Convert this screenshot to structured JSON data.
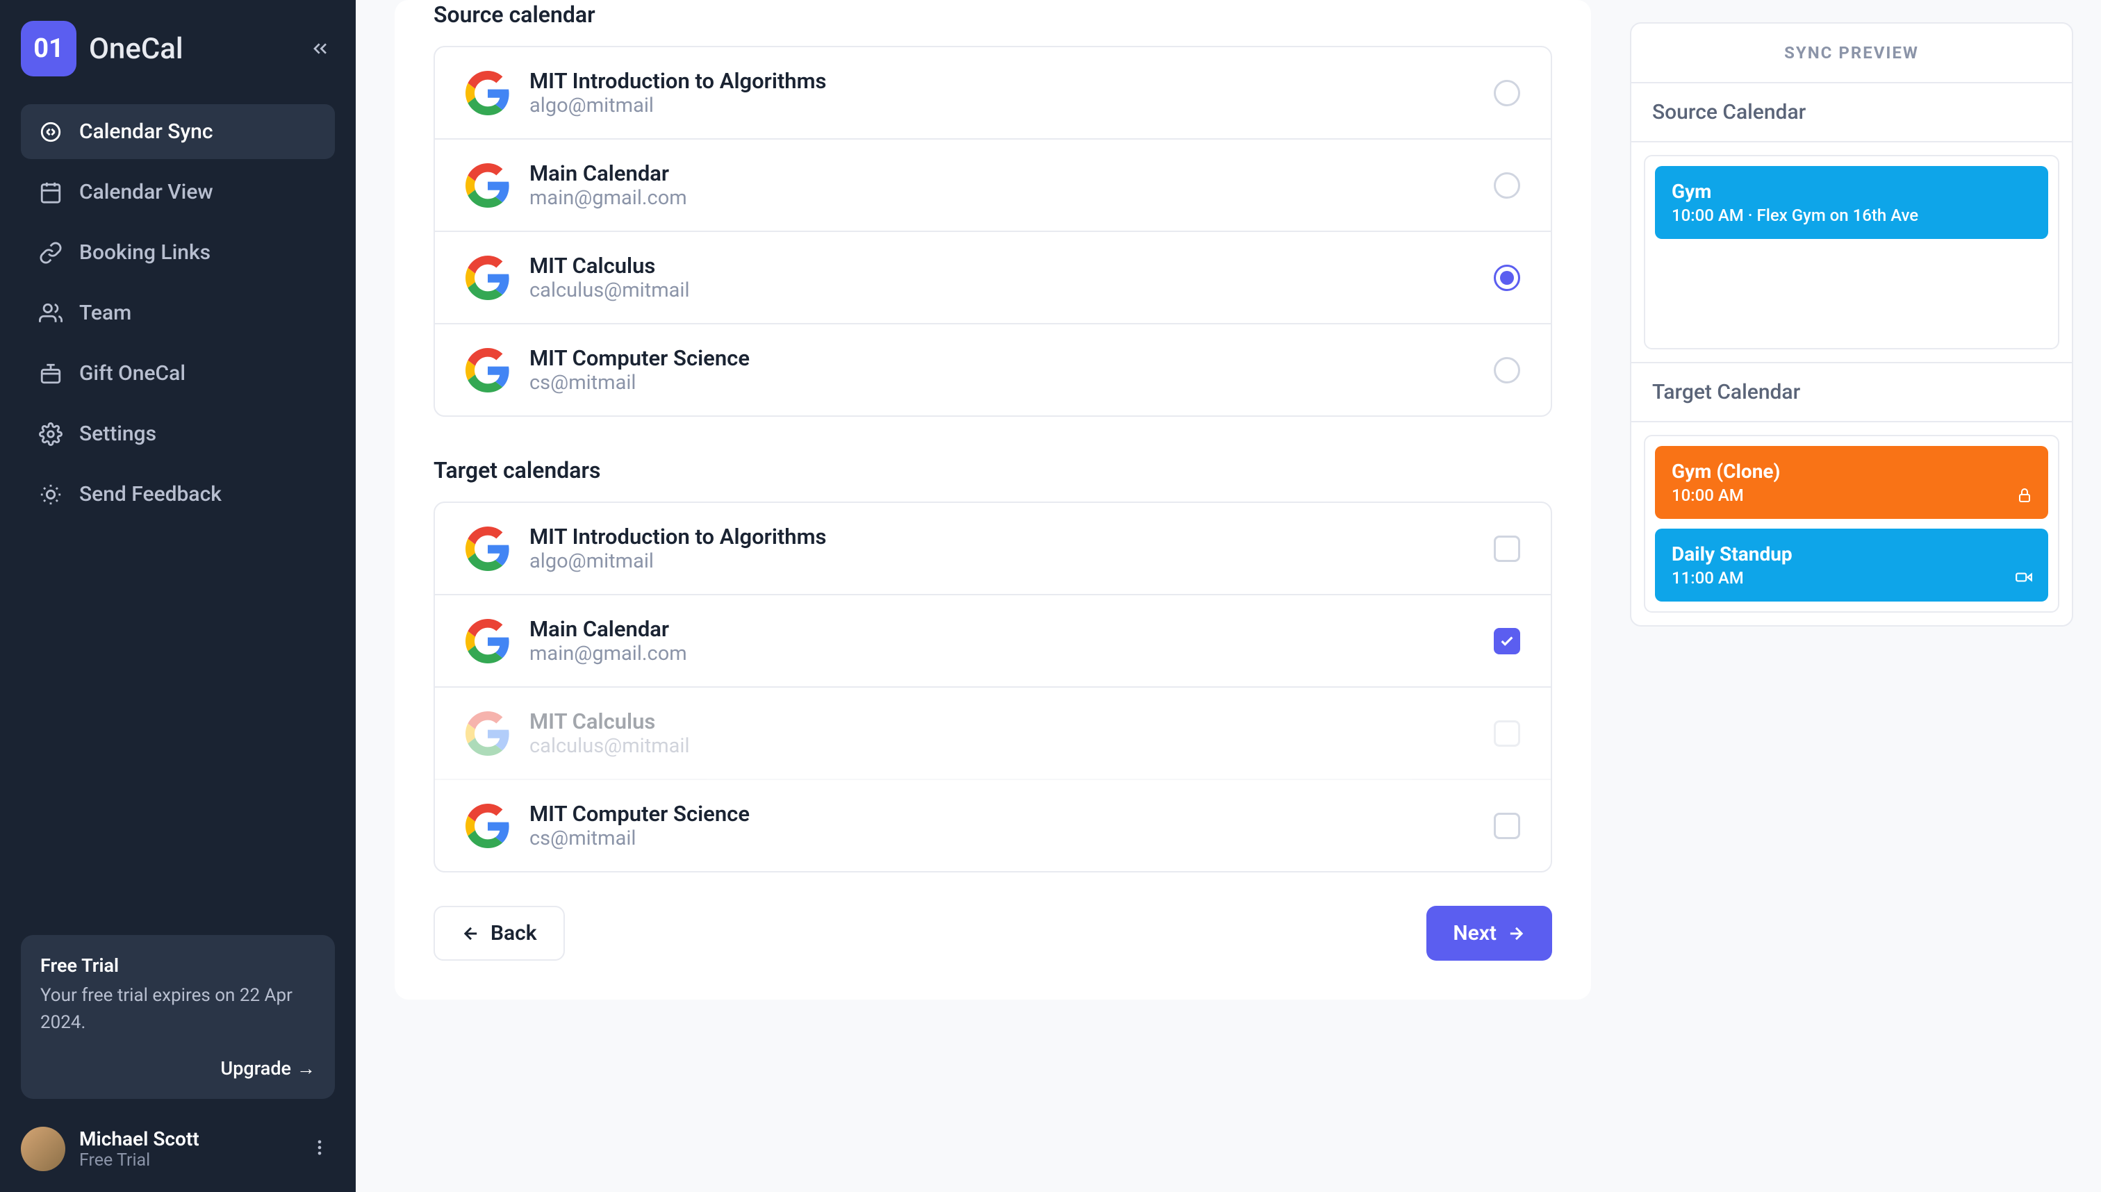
{
  "brand": {
    "badge": "01",
    "name": "OneCal"
  },
  "nav": [
    {
      "label": "Calendar Sync",
      "active": true
    },
    {
      "label": "Calendar View",
      "active": false
    },
    {
      "label": "Booking Links",
      "active": false
    },
    {
      "label": "Team",
      "active": false
    },
    {
      "label": "Gift OneCal",
      "active": false
    },
    {
      "label": "Settings",
      "active": false
    },
    {
      "label": "Send Feedback",
      "active": false
    }
  ],
  "trial": {
    "title": "Free Trial",
    "text": "Your free trial expires on 22 Apr 2024.",
    "cta": "Upgrade"
  },
  "user": {
    "name": "Michael Scott",
    "plan": "Free Trial"
  },
  "sections": {
    "source_header": "Source calendar",
    "target_header": "Target calendars"
  },
  "source_calendars": [
    {
      "name": "MIT Introduction to Algorithms",
      "email": "algo@mitmail",
      "selected": false,
      "disabled": false
    },
    {
      "name": "Main Calendar",
      "email": "main@gmail.com",
      "selected": false,
      "disabled": false
    },
    {
      "name": "MIT Calculus",
      "email": "calculus@mitmail",
      "selected": true,
      "disabled": false
    },
    {
      "name": "MIT Computer Science",
      "email": "cs@mitmail",
      "selected": false,
      "disabled": false
    }
  ],
  "target_calendars": [
    {
      "name": "MIT Introduction to Algorithms",
      "email": "algo@mitmail",
      "checked": false,
      "disabled": false
    },
    {
      "name": "Main Calendar",
      "email": "main@gmail.com",
      "checked": true,
      "disabled": false
    },
    {
      "name": "MIT Calculus",
      "email": "calculus@mitmail",
      "checked": false,
      "disabled": true
    },
    {
      "name": "MIT Computer Science",
      "email": "cs@mitmail",
      "checked": false,
      "disabled": false
    }
  ],
  "buttons": {
    "back": "Back",
    "next": "Next"
  },
  "preview": {
    "title": "SYNC PREVIEW",
    "source_header": "Source Calendar",
    "target_header": "Target Calendar",
    "source_events": [
      {
        "title": "Gym",
        "sub": "10:00 AM · Flex Gym on 16th Ave",
        "color": "blue",
        "icon": null
      }
    ],
    "target_events": [
      {
        "title": "Gym (Clone)",
        "sub": "10:00 AM",
        "color": "orange",
        "icon": "lock"
      },
      {
        "title": "Daily Standup",
        "sub": "11:00 AM",
        "color": "blue",
        "icon": "video"
      }
    ]
  }
}
